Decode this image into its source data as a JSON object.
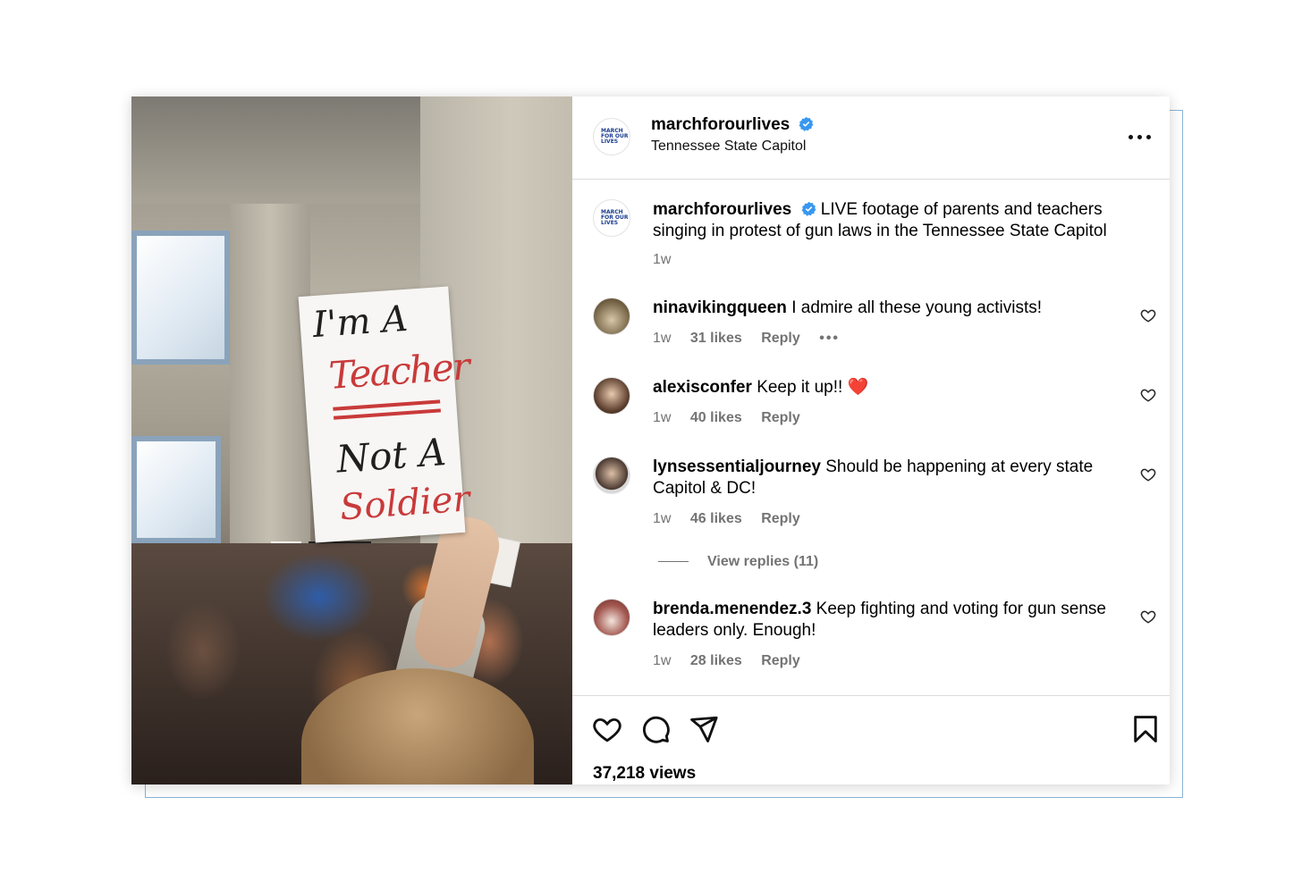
{
  "post": {
    "account": "marchforourlives",
    "location": "Tennessee State Capitol",
    "avatar_text": "MARCH\nFOR OUR\nLIVES",
    "caption": {
      "username": "marchforourlives",
      "text": "LIVE footage of parents and teachers singing in protest of gun laws in the Tennessee State Capitol",
      "time": "1w"
    },
    "sign_text": {
      "line1": "I'm A",
      "line2": "Teacher",
      "line3": "Not A",
      "line4": "Soldier"
    },
    "views": "37,218 views"
  },
  "comments": [
    {
      "username": "ninavikingqueen",
      "text": "I admire all these young activists!",
      "time": "1w",
      "likes": "31 likes",
      "reply": "Reply",
      "more_icon": "more-icon"
    },
    {
      "username": "alexisconfer",
      "text": "Keep it up!! ❤️",
      "time": "1w",
      "likes": "40 likes",
      "reply": "Reply"
    },
    {
      "username": "lynsessentialjourney",
      "text": "Should be happening at every state Capitol & DC!",
      "time": "1w",
      "likes": "46 likes",
      "reply": "Reply",
      "view_replies": "View replies (11)"
    },
    {
      "username": "brenda.menendez.3",
      "text": "Keep fighting and voting for gun sense leaders only. Enough!",
      "time": "1w",
      "likes": "28 likes",
      "reply": "Reply"
    }
  ],
  "icons": [
    "verified-icon",
    "more-icon",
    "heart-icon",
    "comment-icon",
    "share-icon",
    "bookmark-icon"
  ],
  "colors": {
    "verified": "#3897f0",
    "meta": "#737373",
    "border": "#dbdbdb"
  }
}
